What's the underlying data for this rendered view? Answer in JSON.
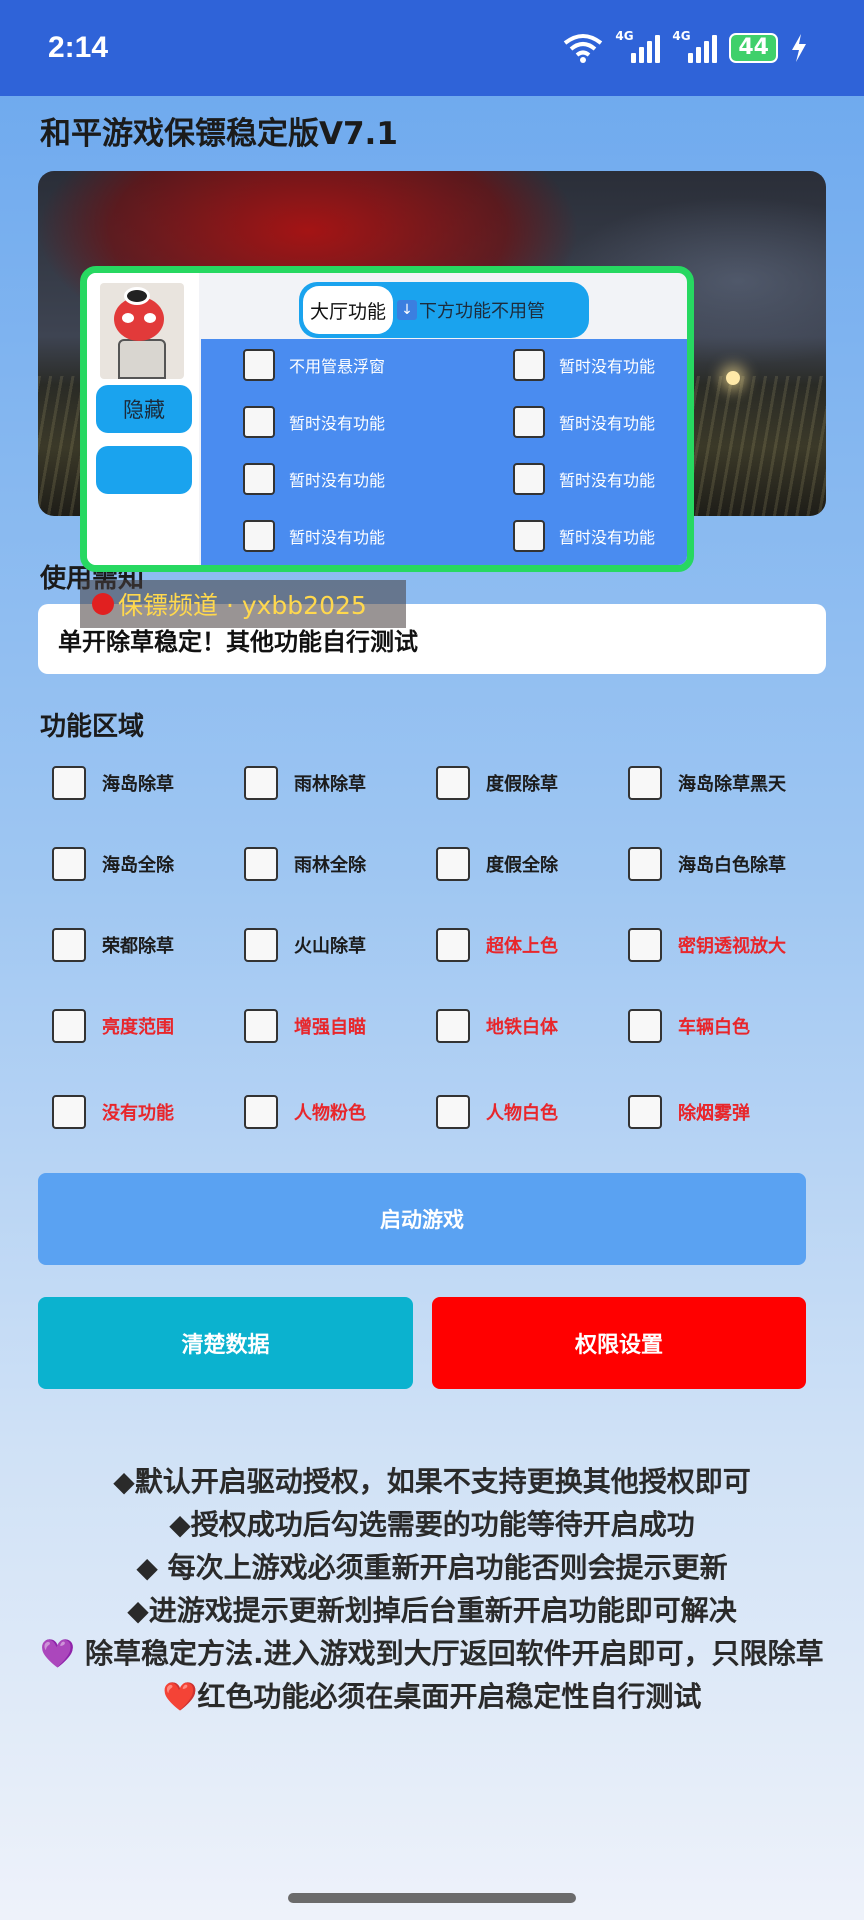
{
  "status_bar": {
    "time": "2:14",
    "signal1_label": "4G",
    "signal2_label": "4G",
    "battery": "44",
    "icons": [
      "wifi-icon",
      "signal-icon",
      "signal-icon",
      "battery-icon",
      "charging-icon"
    ]
  },
  "app": {
    "title": "和平游戏保镖稳定版V7.1"
  },
  "floating_window": {
    "hide_label": "隐藏",
    "tab_active": "大厅功能",
    "tab_other": "下方功能不用管",
    "tab_arrow": "↓",
    "items": [
      "不用管悬浮窗",
      "暂时没有功能",
      "暂时没有功能",
      "暂时没有功能",
      "暂时没有功能",
      "暂时没有功能",
      "暂时没有功能",
      "暂时没有功能"
    ],
    "border_color": "#27d861"
  },
  "usage": {
    "label": "使用需知",
    "notice": "单开除草稳定！其他功能自行测试"
  },
  "watermark": {
    "text": "保镖频道 · yxbb2025"
  },
  "features": {
    "label": "功能区域",
    "rows": [
      [
        {
          "label": "海岛除草",
          "red": false
        },
        {
          "label": "雨林除草",
          "red": false
        },
        {
          "label": "度假除草",
          "red": false
        },
        {
          "label": "海岛除草黑天",
          "red": false
        }
      ],
      [
        {
          "label": "海岛全除",
          "red": false
        },
        {
          "label": "雨林全除",
          "red": false
        },
        {
          "label": "度假全除",
          "red": false
        },
        {
          "label": "海岛白色除草",
          "red": false
        }
      ],
      [
        {
          "label": "荣都除草",
          "red": false
        },
        {
          "label": "火山除草",
          "red": false
        },
        {
          "label": "超体上色",
          "red": true
        },
        {
          "label": "密钥透视放大",
          "red": true
        }
      ],
      [
        {
          "label": "亮度范围",
          "red": true
        },
        {
          "label": "增强自瞄",
          "red": true
        },
        {
          "label": "地铁白体",
          "red": true
        },
        {
          "label": "车辆白色",
          "red": true
        }
      ],
      [
        {
          "label": "没有功能",
          "red": true
        },
        {
          "label": "人物粉色",
          "red": true
        },
        {
          "label": "人物白色",
          "red": true
        },
        {
          "label": "除烟雾弹",
          "red": true
        }
      ]
    ]
  },
  "buttons": {
    "start": "启动游戏",
    "clear": "清楚数据",
    "permission": "权限设置"
  },
  "notes": [
    "◆默认开启驱动授权，如果不支持更换其他授权即可",
    "◆授权成功后勾选需要的功能等待开启成功",
    "◆ 每次上游戏必须重新开启功能否则会提示更新",
    "◆进游戏提示更新划掉后台重新开启功能即可解决",
    "💜 除草稳定方法.进入游戏到大厅返回软件开启即可，只限除草",
    "❤️红色功能必须在桌面开启稳定性自行测试"
  ],
  "colors": {
    "status_bar": "#2f63d8",
    "accent_red": "#e8262b",
    "start_button": "#5aa2f2",
    "clear_button": "#0bb2cf",
    "permission_button": "#ff0000"
  }
}
